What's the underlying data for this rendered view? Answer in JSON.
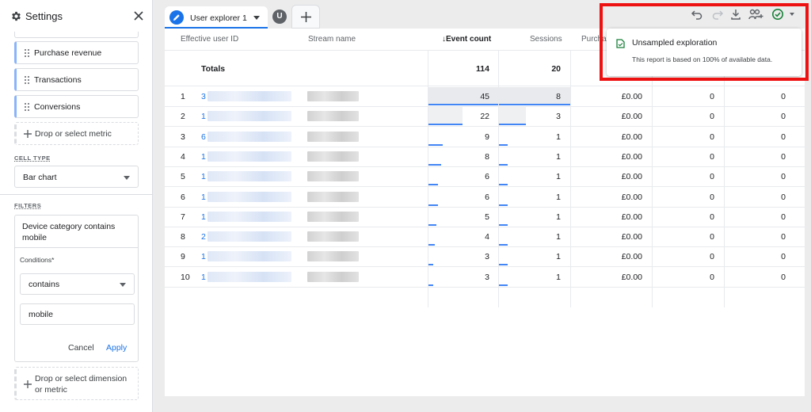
{
  "settings": {
    "title": "Settings",
    "metrics": [
      "Purchase revenue",
      "Transactions",
      "Conversions"
    ],
    "drop_metric": "Drop or select metric",
    "cell_type_label": "CELL TYPE",
    "cell_type_value": "Bar chart",
    "filters_label": "FILTERS",
    "filter": {
      "title": "Device category contains mobile",
      "conditions_label": "Conditions*",
      "operator": "contains",
      "value": "mobile",
      "cancel": "Cancel",
      "apply": "Apply"
    },
    "drop_dimension": "Drop or select dimension or metric"
  },
  "tabs": {
    "active": "User explorer 1",
    "avatar": "U"
  },
  "table": {
    "headers": {
      "user_id": "Effective user ID",
      "stream": "Stream name",
      "event_count": "↓Event count",
      "sessions": "Sessions",
      "purchase": "Purcha"
    },
    "totals_label": "Totals",
    "totals_event": "114",
    "totals_sessions": "20",
    "rows": [
      {
        "n": "1",
        "id": "3",
        "event": "45",
        "sessions": "8",
        "rev": "£0.00",
        "c1": "0",
        "c2": "0"
      },
      {
        "n": "2",
        "id": "1",
        "event": "22",
        "sessions": "3",
        "rev": "£0.00",
        "c1": "0",
        "c2": "0"
      },
      {
        "n": "3",
        "id": "6",
        "event": "9",
        "sessions": "1",
        "rev": "£0.00",
        "c1": "0",
        "c2": "0"
      },
      {
        "n": "4",
        "id": "1",
        "event": "8",
        "sessions": "1",
        "rev": "£0.00",
        "c1": "0",
        "c2": "0"
      },
      {
        "n": "5",
        "id": "1",
        "event": "6",
        "sessions": "1",
        "rev": "£0.00",
        "c1": "0",
        "c2": "0"
      },
      {
        "n": "6",
        "id": "1",
        "event": "6",
        "sessions": "1",
        "rev": "£0.00",
        "c1": "0",
        "c2": "0"
      },
      {
        "n": "7",
        "id": "1",
        "event": "5",
        "sessions": "1",
        "rev": "£0.00",
        "c1": "0",
        "c2": "0"
      },
      {
        "n": "8",
        "id": "2",
        "event": "4",
        "sessions": "1",
        "rev": "£0.00",
        "c1": "0",
        "c2": "0"
      },
      {
        "n": "9",
        "id": "1",
        "event": "3",
        "sessions": "1",
        "rev": "£0.00",
        "c1": "0",
        "c2": "0"
      },
      {
        "n": "10",
        "id": "1",
        "event": "3",
        "sessions": "1",
        "rev": "£0.00",
        "c1": "0",
        "c2": "0"
      }
    ]
  },
  "popup": {
    "title": "Unsampled exploration",
    "body": "This report is based on 100% of available data."
  },
  "colors": {
    "accent": "#1a73e8",
    "highlight": "#ee1111",
    "bar": "#4285f4"
  },
  "icons": [
    "gear-icon",
    "close-icon",
    "drag-handle-icon",
    "plus-icon",
    "pencil-icon",
    "undo-icon",
    "redo-icon",
    "download-icon",
    "share-user-icon",
    "check-circle-icon",
    "document-check-icon"
  ]
}
